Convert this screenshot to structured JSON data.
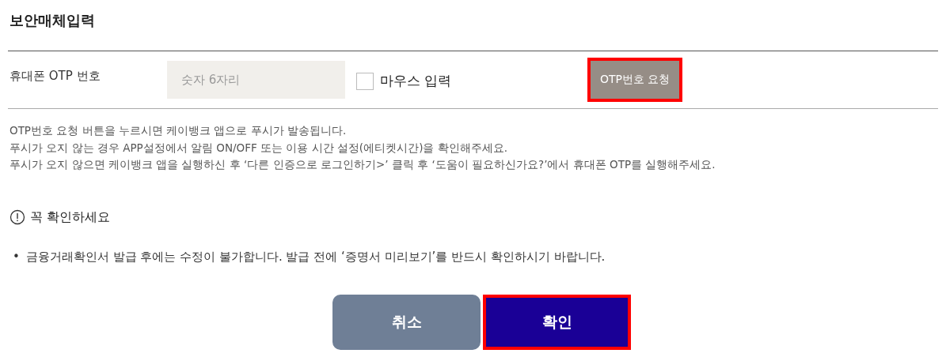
{
  "title": "보안매체입력",
  "otp_row": {
    "label": "휴대폰 OTP 번호",
    "input": {
      "placeholder": "숫자 6자리"
    },
    "mouse_input": {
      "label": "마우스 입력",
      "checked": false
    },
    "request_button": {
      "label": "OTP번호 요청",
      "highlighted": true
    }
  },
  "notes": [
    "OTP번호 요청 버튼을 누르시면 케이뱅크 앱으로 푸시가 발송됩니다.",
    "푸시가 오지 않는 경우 APP설정에서 알림 ON/OFF 또는 이용 시간 설정(에티켓시간)을 확인해주세요.",
    "푸시가 오지 않으면 케이뱅크 앱을 실행하신 후 ‘다른 인증으로 로그인하기>’ 클릭 후 ‘도움이 필요하신가요?’에서 휴대폰 OTP를 실행해주세요."
  ],
  "notice": {
    "heading": "꼭 확인하세요",
    "items": [
      {
        "bullet": "•",
        "text": "금융거래확인서 발급 후에는 수정이 불가합니다. 발급 전에 ‘증명서 미리보기’를 반드시 확인하시기 바랍니다."
      }
    ]
  },
  "buttons": [
    {
      "kind": "secondary",
      "label": "취소",
      "highlighted": false
    },
    {
      "kind": "primary",
      "label": "확인",
      "highlighted": true
    }
  ]
}
